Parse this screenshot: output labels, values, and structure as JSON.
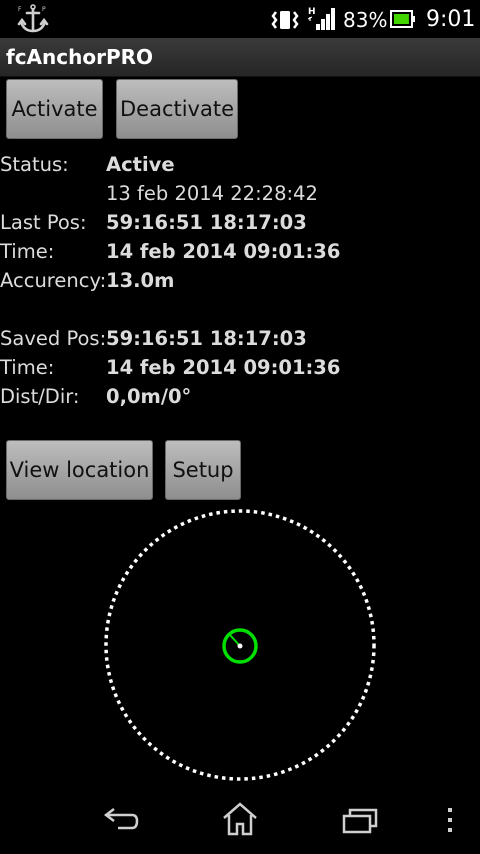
{
  "status_bar": {
    "battery_percent": "83%",
    "time": "9:01",
    "icons": [
      "anchor-notification-icon",
      "vibrate-icon",
      "signal-icon",
      "battery-icon"
    ],
    "battery_level": 0.83
  },
  "app": {
    "title": "fcAnchorPRO"
  },
  "buttons": {
    "activate": "Activate",
    "deactivate": "Deactivate",
    "view_location": "View location",
    "setup": "Setup"
  },
  "info": {
    "status_label": "Status:",
    "status_value": "Active",
    "status_time": "13 feb 2014 22:28:42",
    "last_pos_label": "Last Pos:",
    "last_pos_value": "59:16:51 18:17:03",
    "time1_label": "Time:",
    "time1_value": "14 feb 2014 09:01:36",
    "accuracy_label": "Accurency:",
    "accuracy_value": "13.0m",
    "saved_pos_label": "Saved Pos:",
    "saved_pos_value": "59:16:51 18:17:03",
    "time2_label": "Time:",
    "time2_value": "14 feb 2014 09:01:36",
    "dist_dir_label": "Dist/Dir:",
    "dist_dir_value": "0,0m/0°"
  },
  "radar": {
    "outer_ring_color": "#ffffff",
    "position_marker_color": "#00e000"
  },
  "nav_bar": {
    "icons": [
      "back-icon",
      "home-icon",
      "recent-apps-icon",
      "menu-icon"
    ]
  }
}
